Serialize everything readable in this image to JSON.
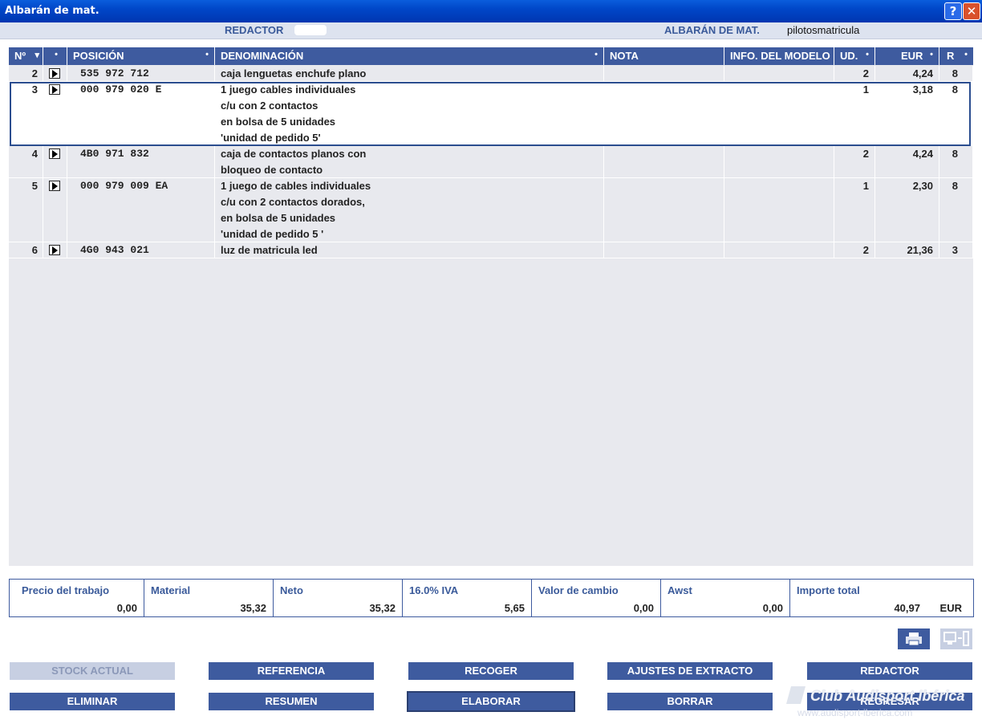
{
  "window": {
    "title": "Albarán de mat.",
    "help_label": "?",
    "close_label": "✕"
  },
  "info": {
    "redactor_label": "REDACTOR",
    "doc_label": "ALBARÁN DE MAT.",
    "doc_value": "pilotosmatricula"
  },
  "columns": {
    "no": "Nº",
    "pos": "POSICIÓN",
    "den": "DENOMINACIÓN",
    "nota": "NOTA",
    "info": "INFO. DEL MODELO",
    "ud": "UD.",
    "eur": "EUR",
    "r": "R",
    "sort_glyph": "▾",
    "dot_glyph": "•"
  },
  "rows": [
    {
      "no": "2",
      "pos": "535 972 712",
      "den": [
        "caja lenguetas enchufe plano"
      ],
      "ud": "2",
      "eur": "4,24",
      "r": "8"
    },
    {
      "no": "3",
      "pos": "000 979 020 E",
      "den": [
        "1 juego cables individuales",
        "c/u con 2 contactos",
        "en bolsa de 5 unidades",
        "'unidad de pedido 5'"
      ],
      "ud": "1",
      "eur": "3,18",
      "r": "8"
    },
    {
      "no": "4",
      "pos": "4B0 971 832",
      "den": [
        "caja de contactos planos con",
        "bloqueo de contacto"
      ],
      "ud": "2",
      "eur": "4,24",
      "r": "8"
    },
    {
      "no": "5",
      "pos": "000 979 009 EA",
      "den": [
        "1 juego de cables individuales",
        "c/u con 2 contactos dorados,",
        "en bolsa de 5 unidades",
        "'unidad de pedido 5 '"
      ],
      "ud": "1",
      "eur": "2,30",
      "r": "8"
    },
    {
      "no": "6",
      "pos": "4G0 943 021",
      "den": [
        "luz de matricula led"
      ],
      "ud": "2",
      "eur": "21,36",
      "r": "3"
    }
  ],
  "totals": [
    {
      "label": "Precio del trabajo",
      "value": "0,00"
    },
    {
      "label": "Material",
      "value": "35,32"
    },
    {
      "label": "Neto",
      "value": "35,32"
    },
    {
      "label": "16.0% IVA",
      "value": "5,65"
    },
    {
      "label": "Valor de cambio",
      "value": "0,00"
    },
    {
      "label": "Awst",
      "value": "0,00"
    },
    {
      "label": "Importe total",
      "value": "40,97",
      "currency": "EUR"
    }
  ],
  "buttons": {
    "stock": "STOCK ACTUAL",
    "referencia": "REFERENCIA",
    "recoger": "RECOGER",
    "ajustes": "AJUSTES DE EXTRACTO",
    "redactor": "REDACTOR",
    "eliminar": "ELIMINAR",
    "resumen": "RESUMEN",
    "elaborar": "ELABORAR",
    "borrar": "BORRAR",
    "regresar": "REGRESAR"
  },
  "watermark": {
    "title": "Club Audisport Ibérica",
    "url": "www.audisport-iberica.com"
  },
  "colors": {
    "header": "#3e5b9f",
    "titlebar": "#0046c8",
    "grid_bg": "#e8e9ee"
  }
}
